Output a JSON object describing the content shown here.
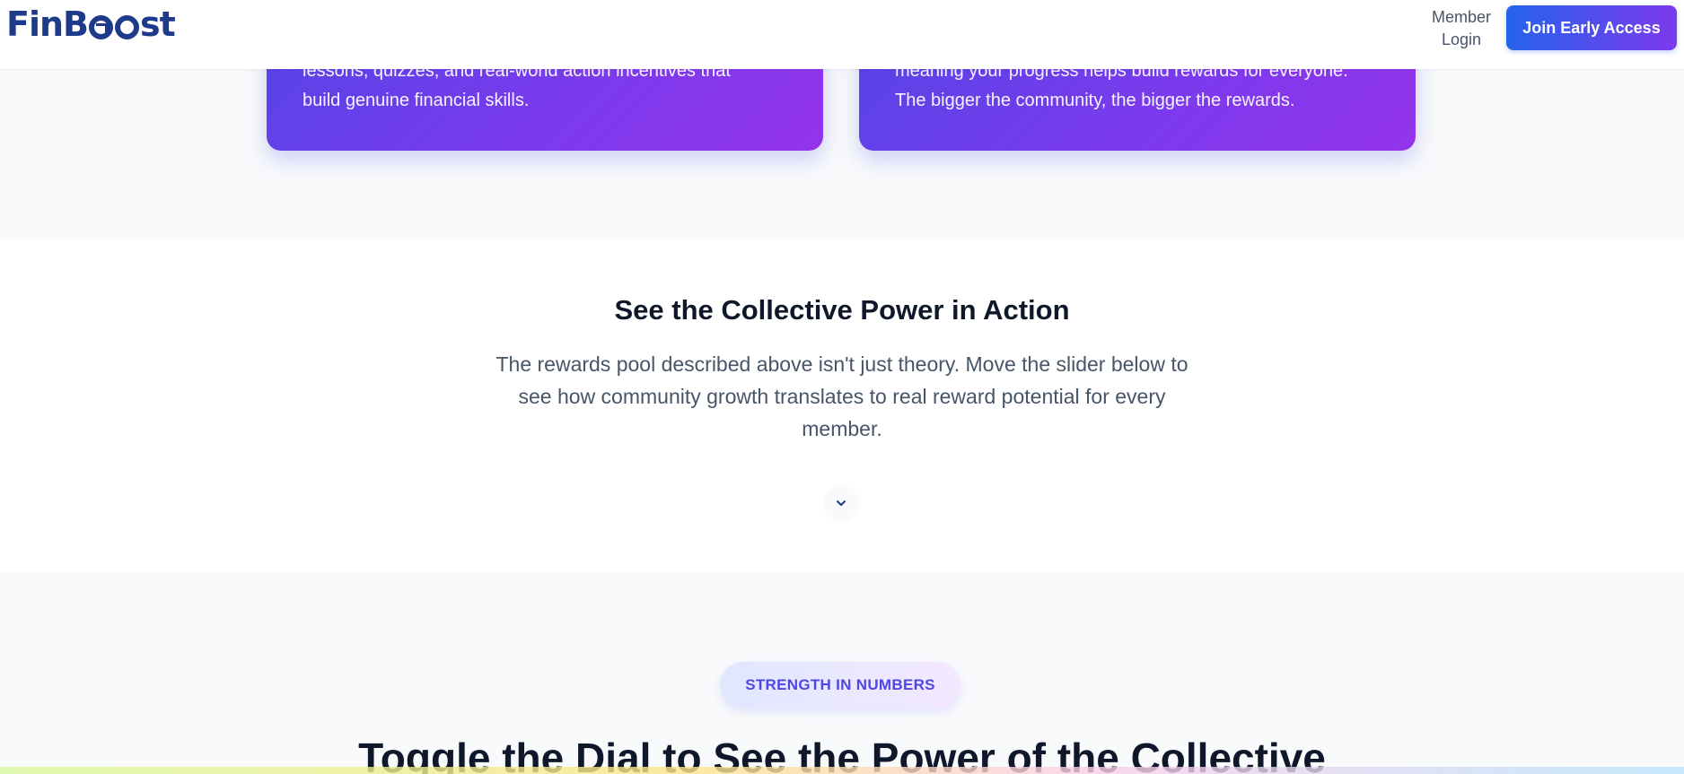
{
  "header": {
    "logo_text": "FinBoost",
    "member_login": "Member Login",
    "member_login_line1": "Member",
    "member_login_line2": "Login",
    "join_button": "Join Early Access"
  },
  "cards": [
    {
      "line1": "lessons, quizzes, and real-world action incentives that",
      "line2": "build genuine financial skills."
    },
    {
      "line1": "meaning your progress helps build rewards for everyone.",
      "line2": "The bigger the community, the bigger the rewards."
    }
  ],
  "collective": {
    "title": "See the Collective Power in Action",
    "description_lines": [
      "The rewards pool described above isn't just theory. Move the slider below to",
      "see how community growth translates to real reward potential for every",
      "member."
    ]
  },
  "numbers": {
    "badge": "STRENGTH IN NUMBERS",
    "title": "Toggle the Dial to See the Power of the Collective"
  },
  "colors": {
    "brand_navy": "#1e3a8a",
    "gradient_start": "#2563eb",
    "gradient_end": "#7c3aed",
    "card_gradient_start": "#4f46e5",
    "card_gradient_end": "#9333ea"
  }
}
